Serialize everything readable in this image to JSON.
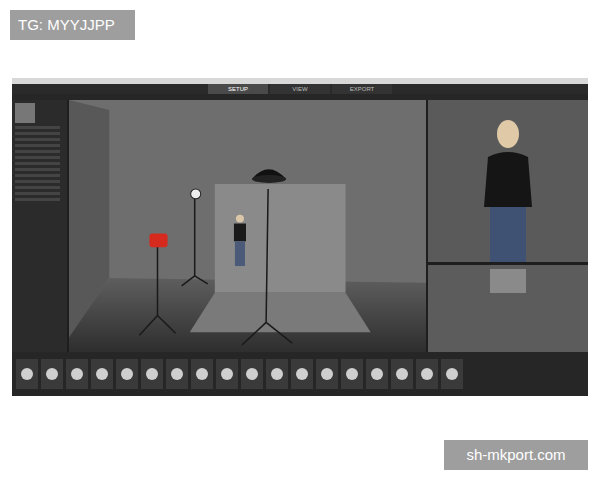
{
  "watermark_top": "TG: MYYJJPP",
  "watermark_bottom": "sh-mkport.com",
  "tabs": [
    {
      "label": "SETUP",
      "selected": true
    },
    {
      "label": "VIEW",
      "selected": false
    },
    {
      "label": "EXPORT",
      "selected": false
    }
  ]
}
